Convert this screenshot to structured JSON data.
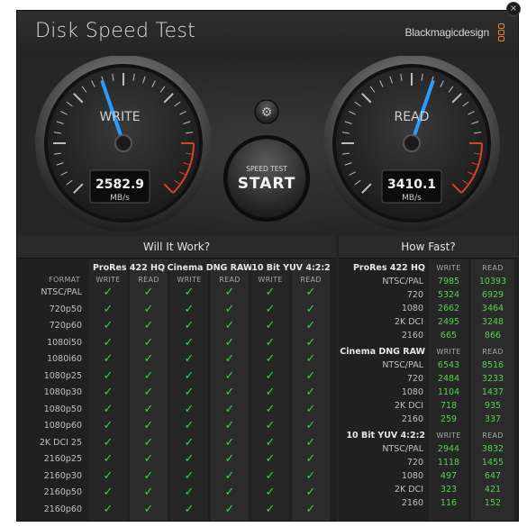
{
  "window": {
    "title": "Disk Speed Test",
    "brand": "Blackmagicdesign",
    "close_glyph": "×"
  },
  "gauges": {
    "write": {
      "label": "WRITE",
      "value": "2582.9",
      "unit": "MB/s",
      "needle_fraction": 0.43
    },
    "read": {
      "label": "READ",
      "value": "3410.1",
      "unit": "MB/s",
      "needle_fraction": 0.57
    },
    "start_button": {
      "top": "SPEED TEST",
      "main": "START"
    },
    "settings_icon": "gear-icon"
  },
  "will_it_work": {
    "title": "Will It Work?",
    "groups": [
      "ProRes 422 HQ",
      "Cinema DNG RAW",
      "10 Bit YUV 4:2:2"
    ],
    "format_header": "FORMAT",
    "write_header": "WRITE",
    "read_header": "READ",
    "check_glyph": "✓",
    "formats": [
      "NTSC/PAL",
      "720p50",
      "720p60",
      "1080i50",
      "1080i60",
      "1080p25",
      "1080p30",
      "1080p50",
      "1080p60",
      "2K DCI 25",
      "2160p25",
      "2160p30",
      "2160p50",
      "2160p60"
    ]
  },
  "how_fast": {
    "title": "How Fast?",
    "write_header": "WRITE",
    "read_header": "READ",
    "groups": [
      {
        "name": "ProRes 422 HQ",
        "rows": [
          {
            "label": "NTSC/PAL",
            "write": "7985",
            "read": "10393"
          },
          {
            "label": "720",
            "write": "5324",
            "read": "6929"
          },
          {
            "label": "1080",
            "write": "2662",
            "read": "3464"
          },
          {
            "label": "2K DCI",
            "write": "2495",
            "read": "3248"
          },
          {
            "label": "2160",
            "write": "665",
            "read": "866"
          }
        ]
      },
      {
        "name": "Cinema DNG RAW",
        "rows": [
          {
            "label": "NTSC/PAL",
            "write": "6543",
            "read": "8516"
          },
          {
            "label": "720",
            "write": "2484",
            "read": "3233"
          },
          {
            "label": "1080",
            "write": "1104",
            "read": "1437"
          },
          {
            "label": "2K DCI",
            "write": "718",
            "read": "935"
          },
          {
            "label": "2160",
            "write": "259",
            "read": "337"
          }
        ]
      },
      {
        "name": "10 Bit YUV 4:2:2",
        "rows": [
          {
            "label": "NTSC/PAL",
            "write": "2944",
            "read": "3832"
          },
          {
            "label": "720",
            "write": "1118",
            "read": "1455"
          },
          {
            "label": "1080",
            "write": "497",
            "read": "647"
          },
          {
            "label": "2K DCI",
            "write": "323",
            "read": "421"
          },
          {
            "label": "2160",
            "write": "116",
            "read": "152"
          }
        ]
      }
    ]
  },
  "colors": {
    "accent_needle": "#2a9bff",
    "check": "#39d34a",
    "numbers": "#54d24c",
    "red_zone": "#d9412e"
  }
}
